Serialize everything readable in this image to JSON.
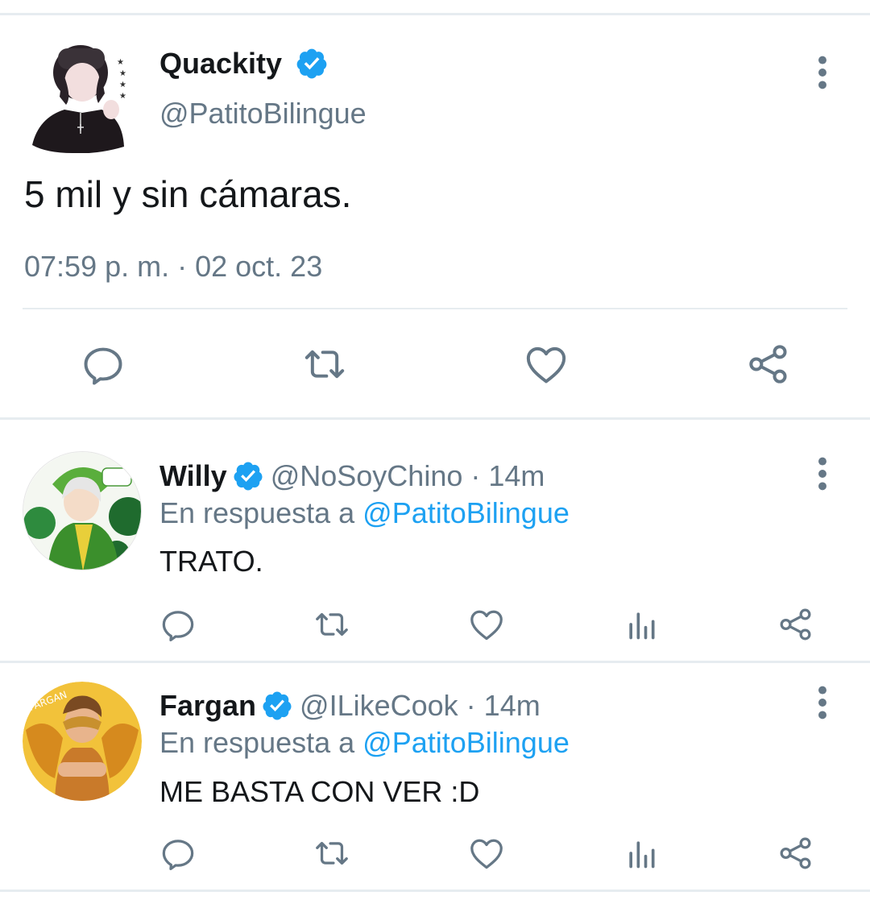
{
  "tweet": {
    "name": "Quackity",
    "handle": "@PatitoBilingue",
    "text": "5 mil y sin cámaras.",
    "timestamp": "07:59 p. m. · 02 oct. 23",
    "actions": [
      "reply-icon",
      "retweet-icon",
      "like-icon",
      "share-icon"
    ]
  },
  "replies": [
    {
      "name": "Willy",
      "handle": "@NoSoyChino",
      "separator": "·",
      "time": "14m",
      "reply_prefix": "En respuesta a",
      "reply_to": "@PatitoBilingue",
      "text": "TRATO.",
      "actions": [
        "reply-icon",
        "retweet-icon",
        "like-icon",
        "analytics-icon",
        "share-icon"
      ]
    },
    {
      "name": "Fargan",
      "handle": "@ILikeCook",
      "separator": "·",
      "time": "14m",
      "reply_prefix": "En respuesta a",
      "reply_to": "@PatitoBilingue",
      "text": "ME BASTA CON VER :D",
      "actions": [
        "reply-icon",
        "retweet-icon",
        "like-icon",
        "analytics-icon",
        "share-icon"
      ]
    }
  ],
  "colors": {
    "verified": "#1da1f2",
    "mention": "#1da1f2",
    "secondary_text": "#657786",
    "icon": "#657786",
    "divider": "#e6ecf0"
  }
}
